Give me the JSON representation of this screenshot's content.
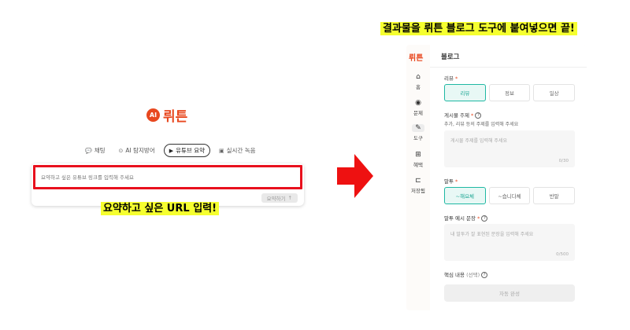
{
  "left": {
    "logo_badge": "AI",
    "logo_text": "뤼튼",
    "modes": [
      {
        "icon": "💬",
        "label": "채팅"
      },
      {
        "icon": "⊙",
        "label": "AI 탐지방어"
      },
      {
        "icon": "▶",
        "label": "유튜브 요약"
      },
      {
        "icon": "▣",
        "label": "실시간 녹음"
      }
    ],
    "input_placeholder": "요약하고 싶은 유튜브 링크를 입력해 주세요",
    "submit_label": "요약하기",
    "submit_icon": "↑",
    "annotation": "요약하고 싶은 URL 입력!"
  },
  "right": {
    "annotation": "결과물을 뤼튼 블로그 도구에 붙여넣으면 끝!",
    "sidebar": {
      "logo": "뤼튼",
      "items": [
        {
          "icon": "⌂",
          "label": "홈"
        },
        {
          "icon": "◉",
          "label": "문제"
        },
        {
          "icon": "✎",
          "label": "도구"
        },
        {
          "icon": "⊞",
          "label": "혜택"
        },
        {
          "icon": "⊏",
          "label": "저장됨"
        }
      ]
    },
    "title": "블로그",
    "review_label": "리뷰",
    "review_options": [
      "리뷰",
      "정보",
      "일상"
    ],
    "topic_label": "게시물 주제",
    "topic_hint": "추가, 리뷰 등의 주제를 입력해 주세요",
    "topic_placeholder": "게시물 주제를 입력해 주세요",
    "topic_count": "0/30",
    "tone_label": "말투",
    "tone_options": [
      "~해요체",
      "~습니다체",
      "반말"
    ],
    "tone_example_label": "말투 예시 문장",
    "tone_example_placeholder": "내 말투가 잘 표현된 문장을 입력해 주세요",
    "tone_example_count": "0/500",
    "core_label": "핵심 내용",
    "core_optional": "(선택)",
    "generate_label": "자동 완성"
  }
}
